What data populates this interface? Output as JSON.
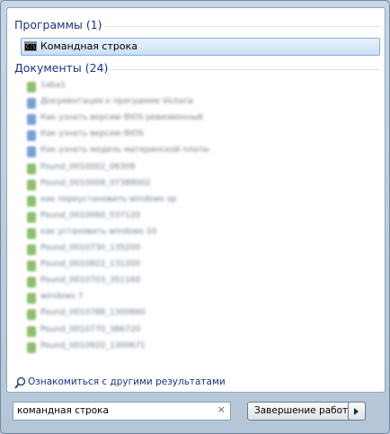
{
  "programs": {
    "header": "Программы (1)",
    "items": [
      {
        "label": "Командная строка",
        "icon": "cmd-icon"
      }
    ]
  },
  "documents": {
    "header": "Документы (24)",
    "items": [
      {
        "label": "1aba1",
        "icon_color": "#8fbf6a"
      },
      {
        "label": "Документация к программе Victoria",
        "icon_color": "#7a9fd6"
      },
      {
        "label": "Как узнать версию BIOS ревизионный",
        "icon_color": "#7a9fd6"
      },
      {
        "label": "Как узнать версию BIOS",
        "icon_color": "#7a9fd6"
      },
      {
        "label": "Как узнать модель материнской платы",
        "icon_color": "#7a9fd6"
      },
      {
        "label": "Pound_0010002_06308",
        "icon_color": "#8fbf6a"
      },
      {
        "label": "Pound_0010008_07389002",
        "icon_color": "#8fbf6a"
      },
      {
        "label": "как переустановить windows xp",
        "icon_color": "#8fbf6a"
      },
      {
        "label": "Pound_0010060_037120",
        "icon_color": "#8fbf6a"
      },
      {
        "label": "как установить windows 10",
        "icon_color": "#8fbf6a"
      },
      {
        "label": "Pound_0010730_135200",
        "icon_color": "#8fbf6a"
      },
      {
        "label": "Pound_0010822_131200",
        "icon_color": "#8fbf6a"
      },
      {
        "label": "Pound_0010703_351160",
        "icon_color": "#8fbf6a"
      },
      {
        "label": "windows 7",
        "icon_color": "#8fbf6a"
      },
      {
        "label": "Pound_0010788_1300660",
        "icon_color": "#8fbf6a"
      },
      {
        "label": "Pound_0010770_386720",
        "icon_color": "#8fbf6a"
      },
      {
        "label": "Pound_0010920_1300671",
        "icon_color": "#8fbf6a"
      }
    ]
  },
  "more_results": "Ознакомиться с другими результатами",
  "search": {
    "value": "командная строка",
    "clear": "×"
  },
  "shutdown": {
    "label": "Завершение работы"
  }
}
